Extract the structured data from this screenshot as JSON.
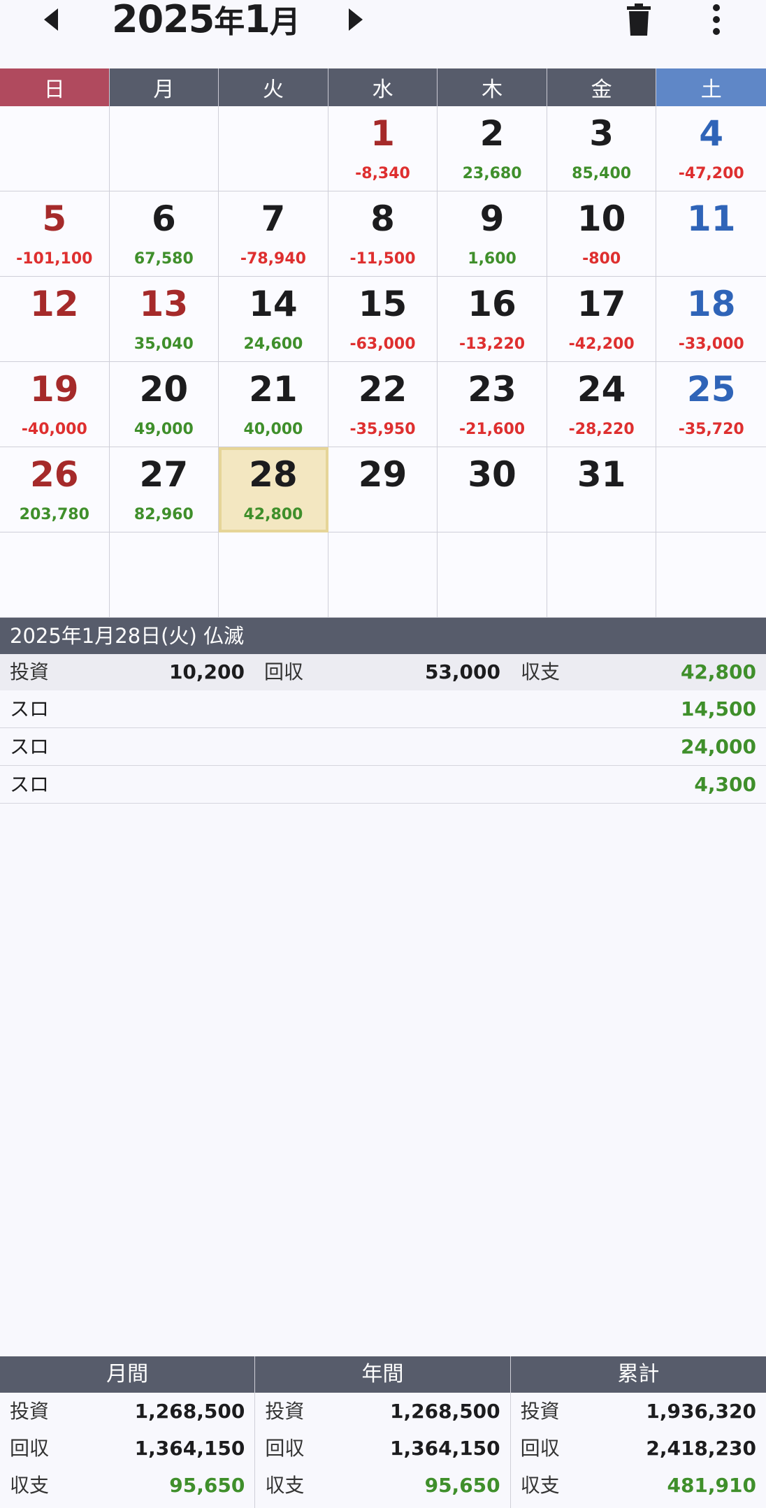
{
  "header": {
    "year_month": "2025",
    "year_kanji": "年",
    "month_number": "1",
    "month_kanji": "月"
  },
  "weekdays": [
    "日",
    "月",
    "火",
    "水",
    "木",
    "金",
    "土"
  ],
  "calendar": [
    {
      "day": "",
      "value": "",
      "sign": "",
      "color": ""
    },
    {
      "day": "",
      "value": "",
      "sign": "",
      "color": ""
    },
    {
      "day": "",
      "value": "",
      "sign": "",
      "color": ""
    },
    {
      "day": "1",
      "value": "-8,340",
      "sign": "neg",
      "color": "red"
    },
    {
      "day": "2",
      "value": "23,680",
      "sign": "pos",
      "color": ""
    },
    {
      "day": "3",
      "value": "85,400",
      "sign": "pos",
      "color": ""
    },
    {
      "day": "4",
      "value": "-47,200",
      "sign": "neg",
      "color": "blue"
    },
    {
      "day": "5",
      "value": "-101,100",
      "sign": "neg",
      "color": "red"
    },
    {
      "day": "6",
      "value": "67,580",
      "sign": "pos",
      "color": ""
    },
    {
      "day": "7",
      "value": "-78,940",
      "sign": "neg",
      "color": ""
    },
    {
      "day": "8",
      "value": "-11,500",
      "sign": "neg",
      "color": ""
    },
    {
      "day": "9",
      "value": "1,600",
      "sign": "pos",
      "color": ""
    },
    {
      "day": "10",
      "value": "-800",
      "sign": "neg",
      "color": ""
    },
    {
      "day": "11",
      "value": "",
      "sign": "",
      "color": "blue"
    },
    {
      "day": "12",
      "value": "",
      "sign": "",
      "color": "red"
    },
    {
      "day": "13",
      "value": "35,040",
      "sign": "pos",
      "color": "red"
    },
    {
      "day": "14",
      "value": "24,600",
      "sign": "pos",
      "color": ""
    },
    {
      "day": "15",
      "value": "-63,000",
      "sign": "neg",
      "color": ""
    },
    {
      "day": "16",
      "value": "-13,220",
      "sign": "neg",
      "color": ""
    },
    {
      "day": "17",
      "value": "-42,200",
      "sign": "neg",
      "color": ""
    },
    {
      "day": "18",
      "value": "-33,000",
      "sign": "neg",
      "color": "blue"
    },
    {
      "day": "19",
      "value": "-40,000",
      "sign": "neg",
      "color": "red"
    },
    {
      "day": "20",
      "value": "49,000",
      "sign": "pos",
      "color": ""
    },
    {
      "day": "21",
      "value": "40,000",
      "sign": "pos",
      "color": ""
    },
    {
      "day": "22",
      "value": "-35,950",
      "sign": "neg",
      "color": ""
    },
    {
      "day": "23",
      "value": "-21,600",
      "sign": "neg",
      "color": ""
    },
    {
      "day": "24",
      "value": "-28,220",
      "sign": "neg",
      "color": ""
    },
    {
      "day": "25",
      "value": "-35,720",
      "sign": "neg",
      "color": "blue"
    },
    {
      "day": "26",
      "value": "203,780",
      "sign": "pos",
      "color": "red"
    },
    {
      "day": "27",
      "value": "82,960",
      "sign": "pos",
      "color": ""
    },
    {
      "day": "28",
      "value": "42,800",
      "sign": "pos",
      "color": "",
      "selected": true
    },
    {
      "day": "29",
      "value": "",
      "sign": "",
      "color": ""
    },
    {
      "day": "30",
      "value": "",
      "sign": "",
      "color": ""
    },
    {
      "day": "31",
      "value": "",
      "sign": "",
      "color": ""
    },
    {
      "day": "",
      "value": "",
      "sign": "",
      "color": ""
    },
    {
      "day": "",
      "value": "",
      "sign": "",
      "color": ""
    },
    {
      "day": "",
      "value": "",
      "sign": "",
      "color": ""
    },
    {
      "day": "",
      "value": "",
      "sign": "",
      "color": ""
    },
    {
      "day": "",
      "value": "",
      "sign": "",
      "color": ""
    },
    {
      "day": "",
      "value": "",
      "sign": "",
      "color": ""
    },
    {
      "day": "",
      "value": "",
      "sign": "",
      "color": ""
    },
    {
      "day": "",
      "value": "",
      "sign": "",
      "color": ""
    }
  ],
  "detail": {
    "title": "2025年1月28日(火)  仏滅",
    "invest_label": "投資",
    "invest_value": "10,200",
    "return_label": "回収",
    "return_value": "53,000",
    "balance_label": "収支",
    "balance_value": "42,800",
    "entries": [
      {
        "type": "スロ",
        "value": "14,500"
      },
      {
        "type": "スロ",
        "value": "24,000"
      },
      {
        "type": "スロ",
        "value": "4,300"
      }
    ]
  },
  "totals": [
    {
      "header": "月間",
      "invest_label": "投資",
      "invest": "1,268,500",
      "return_label": "回収",
      "return": "1,364,150",
      "balance_label": "収支",
      "balance": "95,650"
    },
    {
      "header": "年間",
      "invest_label": "投資",
      "invest": "1,268,500",
      "return_label": "回収",
      "return": "1,364,150",
      "balance_label": "収支",
      "balance": "95,650"
    },
    {
      "header": "累計",
      "invest_label": "投資",
      "invest": "1,936,320",
      "return_label": "回収",
      "return": "2,418,230",
      "balance_label": "収支",
      "balance": "481,910"
    }
  ],
  "colors": {
    "header_bar": "#575c6b",
    "sunday": "#b04a5e",
    "saturday": "#5f87c7",
    "positive": "#3f8f2b",
    "negative": "#de2f2f",
    "selected": "#f3e7c1"
  },
  "icons": {
    "prev": "chevron-left-icon",
    "next": "chevron-right-icon",
    "trash": "trash-icon",
    "more": "more-vertical-icon"
  }
}
